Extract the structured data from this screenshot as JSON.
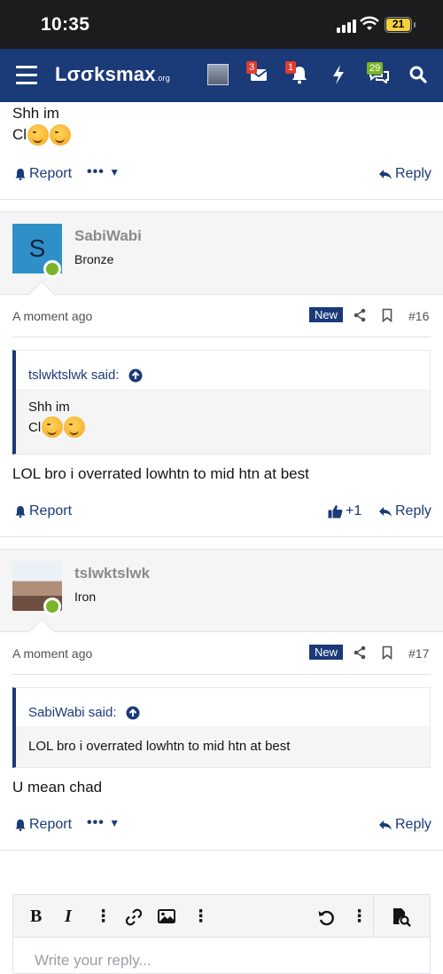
{
  "status_bar": {
    "time": "10:35",
    "battery": "21"
  },
  "nav": {
    "logo_main": "Lσσksmax",
    "logo_suffix": ".org",
    "badges": {
      "messages": "3",
      "alerts": "1",
      "chat": "29"
    }
  },
  "prev_post": {
    "line1": "Shh im",
    "line2": "Cl",
    "report": "Report",
    "reply": "Reply"
  },
  "posts": [
    {
      "avatar_letter": "S",
      "username": "SabiWabi",
      "rank": "Bronze",
      "time": "A moment ago",
      "new_label": "New",
      "number": "#16",
      "quote_author": "tslwktslwk said:",
      "quote_line1": "Shh im",
      "quote_line2": "Cl",
      "body": "LOL bro i overrated lowhtn to mid htn at best",
      "report": "Report",
      "like_count": "+1",
      "reply": "Reply"
    },
    {
      "username": "tslwktslwk",
      "rank": "Iron",
      "time": "A moment ago",
      "new_label": "New",
      "number": "#17",
      "quote_author": "SabiWabi said:",
      "quote_line1": "LOL bro i overrated lowhtn to mid htn at best",
      "body": "U mean chad",
      "report": "Report",
      "reply": "Reply"
    }
  ],
  "editor": {
    "placeholder": "Write your reply..."
  },
  "colors": {
    "nav": "#1a3a78",
    "accent": "#1a3a78",
    "online": "#7ab42a",
    "badge_red": "#e03c31"
  }
}
